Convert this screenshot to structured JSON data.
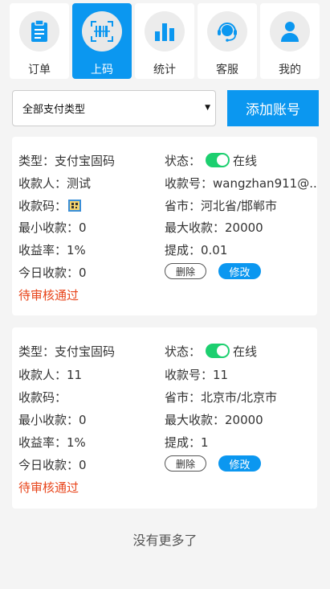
{
  "nav": [
    {
      "label": "订单",
      "icon": "order-clipboard-icon",
      "active": false
    },
    {
      "label": "上码",
      "icon": "barcode-upload-icon",
      "active": true
    },
    {
      "label": "统计",
      "icon": "bar-chart-icon",
      "active": false
    },
    {
      "label": "客服",
      "icon": "headset-support-icon",
      "active": false
    },
    {
      "label": "我的",
      "icon": "user-profile-icon",
      "active": false
    }
  ],
  "filter": {
    "select_value": "全部支付类型",
    "add_label": "添加账号"
  },
  "cards": [
    {
      "type": "类型：支付宝固码",
      "status_label": "状态：",
      "status_value": "在线",
      "payee": "收款人：测试",
      "account": "收款号：wangzhan911@...",
      "qr_label": "收款码：",
      "region": "省市：河北省/邯郸市",
      "min": "最小收款：0",
      "max": "最大收款：20000",
      "rate": "收益率：1%",
      "commission": "提成：0.01",
      "today": "今日收款：0",
      "delete_label": "删除",
      "edit_label": "修改",
      "review": "待审核通过"
    },
    {
      "type": "类型：支付宝固码",
      "status_label": "状态：",
      "status_value": "在线",
      "payee": "收款人：11",
      "account": "收款号：11",
      "qr_label": "收款码：",
      "region": "省市：北京市/北京市",
      "min": "最小收款：0",
      "max": "最大收款：20000",
      "rate": "收益率：1%",
      "commission": "提成：1",
      "today": "今日收款：0",
      "delete_label": "删除",
      "edit_label": "修改",
      "review": "待审核通过"
    }
  ],
  "footer": "没有更多了",
  "colors": {
    "accent": "#0b97f0",
    "toggle_on": "#1ccf6f",
    "pending": "#e8441a"
  }
}
